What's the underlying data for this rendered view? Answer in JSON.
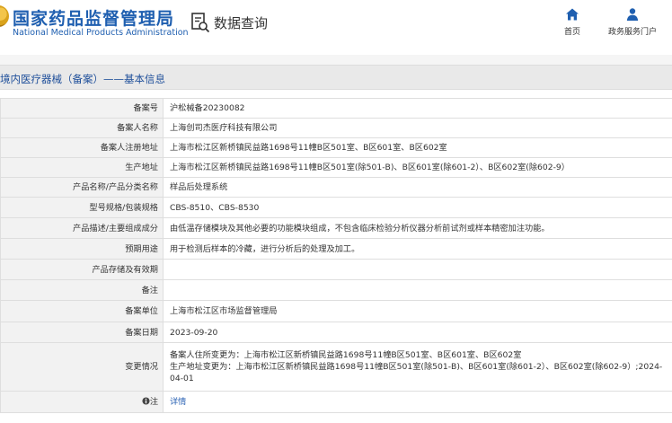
{
  "header": {
    "logo_cn": "国家药品监督管理局",
    "logo_en": "National Medical Products Administration",
    "query_title": "数据查询",
    "nav": [
      {
        "label": "首页",
        "icon": "home-icon"
      },
      {
        "label": "政务服务门户",
        "icon": "user-icon"
      }
    ]
  },
  "section": {
    "title": "境内医疗器械（备案）——基本信息"
  },
  "rows": [
    {
      "label": "备案号",
      "value": "沪松械备20230082"
    },
    {
      "label": "备案人名称",
      "value": "上海创司杰医疗科技有限公司"
    },
    {
      "label": "备案人注册地址",
      "value": "上海市松江区新桥镇民益路1698号11幢B区501室、B区601室、B区602室"
    },
    {
      "label": "生产地址",
      "value": "上海市松江区新桥镇民益路1698号11幢B区501室(除501-B)、B区601室(除601-2）、B区602室(除602-9）"
    },
    {
      "label": "产品名称/产品分类名称",
      "value": "样品后处理系统"
    },
    {
      "label": "型号规格/包装规格",
      "value": "CBS-8510、CBS-8530"
    },
    {
      "label": "产品描述/主要组成成分",
      "value": "由低温存储模块及其他必要的功能模块组成，不包含临床检验分析仪器分析前试剂或样本精密加注功能。"
    },
    {
      "label": "预期用途",
      "value": "用于检测后样本的冷藏，进行分析后的处理及加工。"
    },
    {
      "label": "产品存储及有效期",
      "value": ""
    },
    {
      "label": "备注",
      "value": ""
    },
    {
      "label": "备案单位",
      "value": "上海市松江区市场监督管理局"
    },
    {
      "label": "备案日期",
      "value": "2023-09-20"
    },
    {
      "label": "变更情况",
      "value": "备案人住所变更为：上海市松江区新桥镇民益路1698号11幢B区501室、B区601室、B区602室\n生产地址变更为：上海市松江区新桥镇民益路1698号11幢B区501室(除501-B)、B区601室(除601-2）、B区602室(除602-9）;2024-04-01"
    },
    {
      "label": "注",
      "value": "详情",
      "label_icon": "info-icon",
      "is_link": true
    }
  ],
  "colors": {
    "brand_blue": "#1f5fb0",
    "section_title": "#1f4f9a",
    "link": "#2a62b4",
    "label_bg": "#f2f2f2",
    "border": "#dedede"
  }
}
